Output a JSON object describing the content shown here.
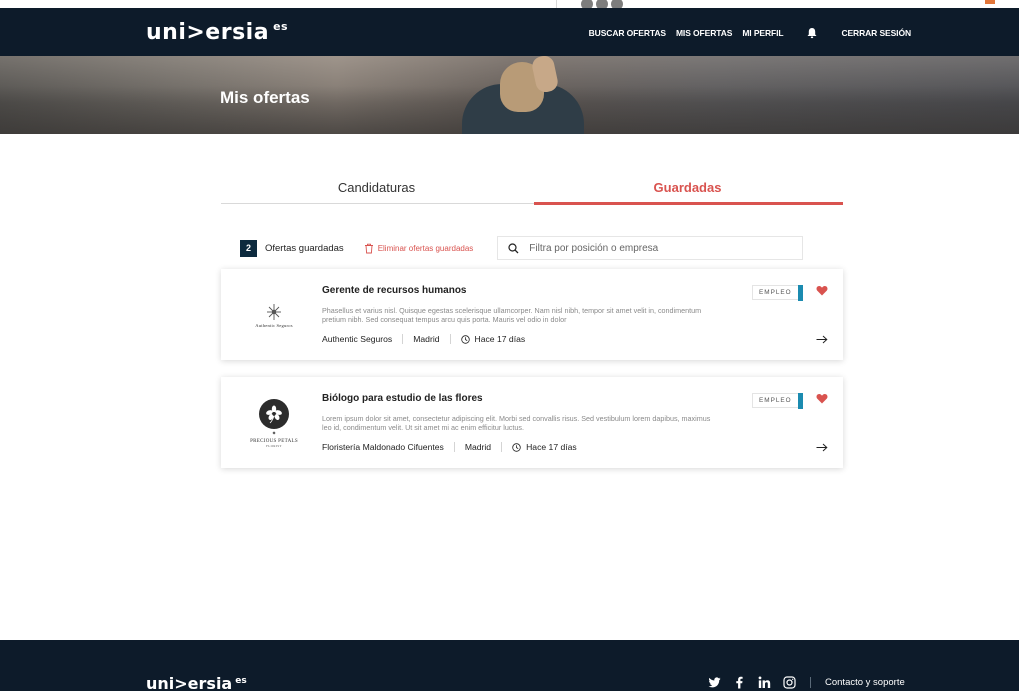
{
  "header": {
    "logo": "uni>ersia",
    "logo_suffix": "es",
    "nav": {
      "buscar": "BUSCAR OFERTAS",
      "mis_ofertas": "MIS OFERTAS",
      "mi_perfil": "MI PERFIL",
      "cerrar": "CERRAR SESIÓN"
    }
  },
  "hero": {
    "title": "Mis ofertas"
  },
  "tabs": [
    {
      "label": "Candidaturas",
      "active": false
    },
    {
      "label": "Guardadas",
      "active": true
    }
  ],
  "toolbar": {
    "count": "2",
    "count_label": "Ofertas guardadas",
    "delete_label": "Eliminar ofertas guardadas",
    "search_placeholder": "Filtra por posición o empresa"
  },
  "offers": [
    {
      "title": "Gerente de recursos humanos",
      "description": "Phasellus et varius nisl. Quisque egestas scelerisque ullamcorper. Nam nisl nibh, tempor sit amet velit in, condimentum pretium nibh. Sed consequat tempus arcu quis porta. Mauris vel odio in dolor",
      "company": "Authentic Seguros",
      "location": "Madrid",
      "posted": "Hace 17 días",
      "type": "EMPLEO",
      "logo_text": "Authentic Seguros"
    },
    {
      "title": "Biólogo para estudio de las flores",
      "description": "Lorem ipsum dolor sit amet, consectetur adipiscing elit. Morbi sed convallis risus. Sed vestibulum lorem dapibus, maximus leo id, condimentum velit. Ut sit amet mi ac enim efficitur luctus.",
      "company": "Floristería Maldonado Cifuentes",
      "location": "Madrid",
      "posted": "Hace 17 días",
      "type": "EMPLEO",
      "logo_text": "PRECIOUS PETALS",
      "logo_sub": "FLORIST"
    }
  ],
  "footer": {
    "logo": "uni>ersia",
    "logo_suffix": "es",
    "support": "Contacto y soporte"
  },
  "colors": {
    "navy": "#0d1b2a",
    "accent": "#d9534f",
    "chip_bar": "#1b8bb0"
  }
}
